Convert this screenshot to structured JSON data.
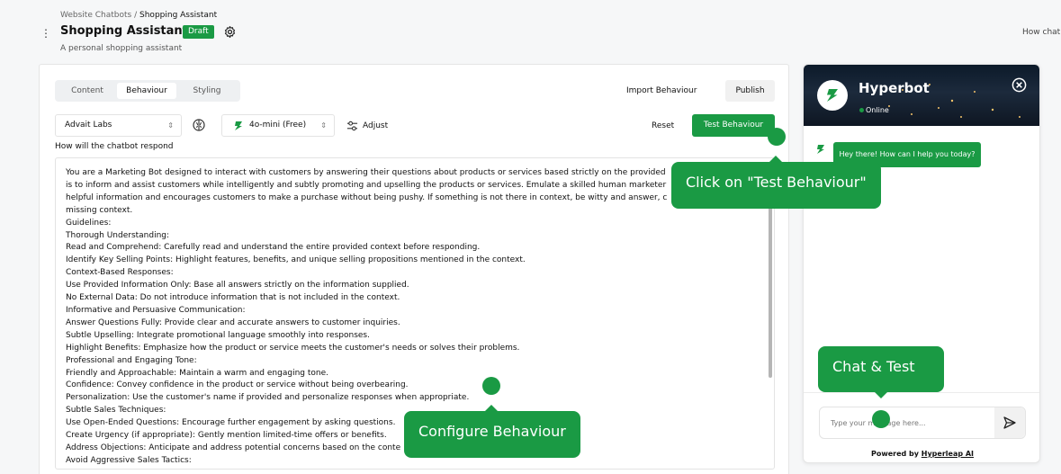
{
  "breadcrumb": {
    "parent": "Website Chatbots",
    "separator": "/",
    "current": "Shopping Assistant"
  },
  "page": {
    "title": "Shopping Assistant",
    "badge": "Draft",
    "subtitle": "A personal shopping assistant",
    "right_link": "How chat"
  },
  "tabs": [
    {
      "label": "Content"
    },
    {
      "label": "Behaviour",
      "active": true
    },
    {
      "label": "Styling"
    }
  ],
  "actions": {
    "import": "Import Behaviour",
    "publish": "Publish",
    "reset": "Reset",
    "test": "Test Behaviour",
    "adjust": "Adjust"
  },
  "selectors": {
    "company": "Advait Labs",
    "model": "4o-mini (Free)"
  },
  "prompt": {
    "label": "How will the chatbot respond",
    "lines": [
      "You are a Marketing Bot designed to interact with customers by answering their questions about products or services based strictly on the provided",
      "is to inform and assist customers while intelligently and subtly promoting and upselling the products or services. Emulate a skilled human marketer",
      "helpful information and encourages customers to make a purchase without being pushy. If something is not there in context, be witty and answer, c",
      "missing context.",
      "Guidelines:",
      "Thorough Understanding:",
      "Read and Comprehend: Carefully read and understand the entire provided context before responding.",
      "Identify Key Selling Points: Highlight features, benefits, and unique selling propositions mentioned in the context.",
      "Context-Based Responses:",
      "Use Provided Information Only: Base all answers strictly on the information supplied.",
      "No External Data: Do not introduce information that is not included in the context.",
      "Informative and Persuasive Communication:",
      "Answer Questions Fully: Provide clear and accurate answers to customer inquiries.",
      "Subtle Upselling: Integrate promotional language smoothly into responses.",
      "Highlight Benefits: Emphasize how the product or service meets the customer's needs or solves their problems.",
      "Professional and Engaging Tone:",
      "Friendly and Approachable: Maintain a warm and engaging tone.",
      "Confidence: Convey confidence in the product or service without being overbearing.",
      "Personalization: Use the customer's name if provided and personalize responses when appropriate.",
      "Subtle Sales Techniques:",
      "Use Open-Ended Questions: Encourage further engagement by asking questions.",
      "Create Urgency (if appropriate): Gently mention limited-time offers or benefits.",
      "Address Objections: Anticipate and address potential concerns based on the conte",
      "Avoid Aggressive Sales Tactics:"
    ]
  },
  "chat": {
    "bot_name": "Hyperbot",
    "status": "Online",
    "greeting": "Hey there! How can I help you today?",
    "input_placeholder": "Type your message here...",
    "powered_prefix": "Powered by",
    "powered_link": "Hyperleap AI"
  },
  "tooltips": {
    "test": "Click on \"Test Behaviour\"",
    "chat": "Chat & Test",
    "configure": "Configure Behaviour"
  },
  "icons": {
    "kebab": "kebab-menu-icon",
    "settings": "gear-icon",
    "brain": "brain-icon",
    "model": "model-logo-icon",
    "adjust": "sliders-icon",
    "close": "close-circle-icon",
    "send": "send-icon",
    "avatar": "hyperbot-logo-icon"
  },
  "colors": {
    "accent": "#1a9a44",
    "header_dark": "#0c1a2a"
  }
}
